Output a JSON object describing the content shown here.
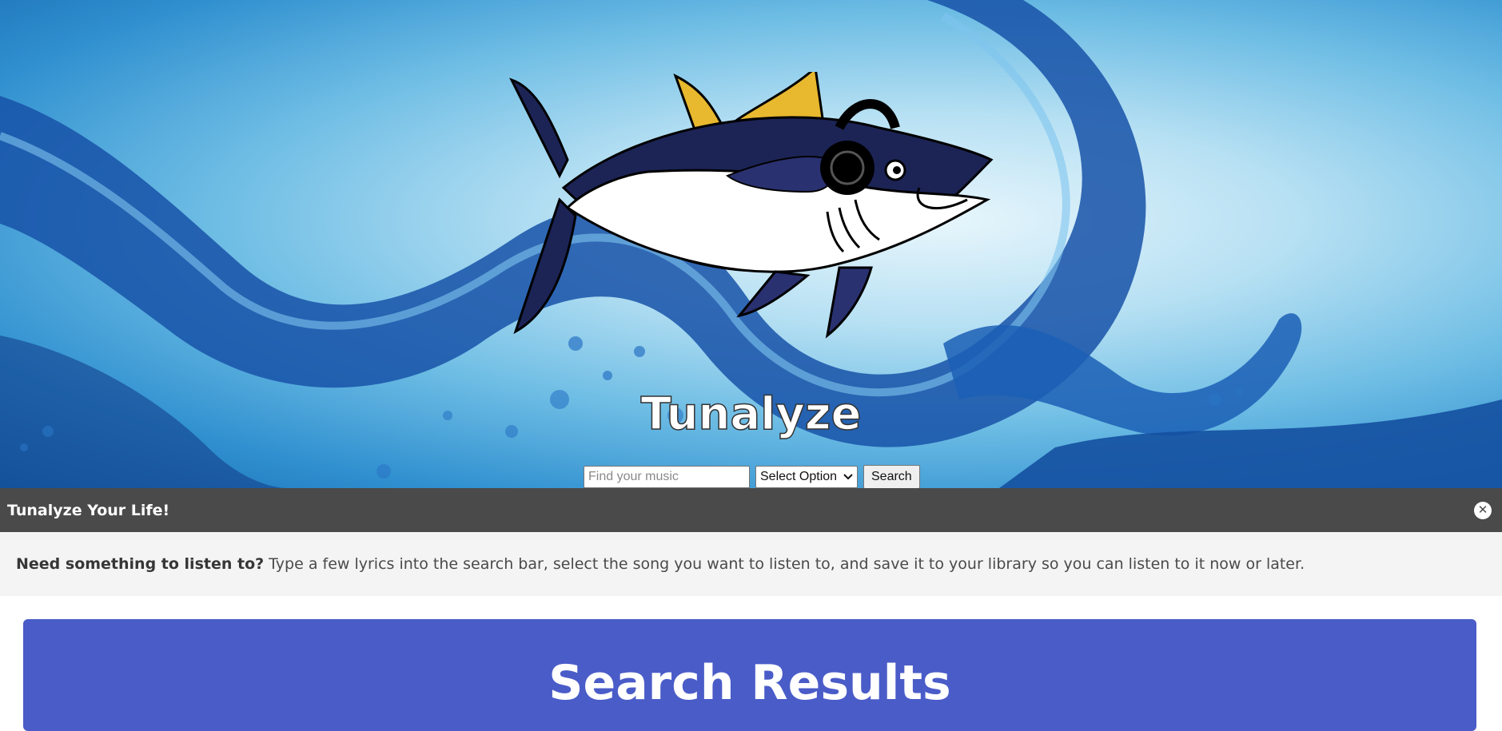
{
  "hero": {
    "site_title": "Tunalyze",
    "logo_icon": "tuna-with-headphones-icon"
  },
  "search": {
    "placeholder": "Find your music",
    "select_value": "Select Option",
    "button_label": "Search"
  },
  "banner": {
    "title": "Tunalyze Your Life!",
    "close_icon": "close-icon",
    "lead": "Need something to listen to?",
    "text": "Type a few lyrics into the search bar, select the song you want to listen to, and save it to your library so you can listen to it now or later."
  },
  "results": {
    "title": "Search Results"
  },
  "colors": {
    "banner_header": "#4a4a4a",
    "banner_body": "#f4f4f4",
    "results_panel": "#4a5cc8"
  }
}
